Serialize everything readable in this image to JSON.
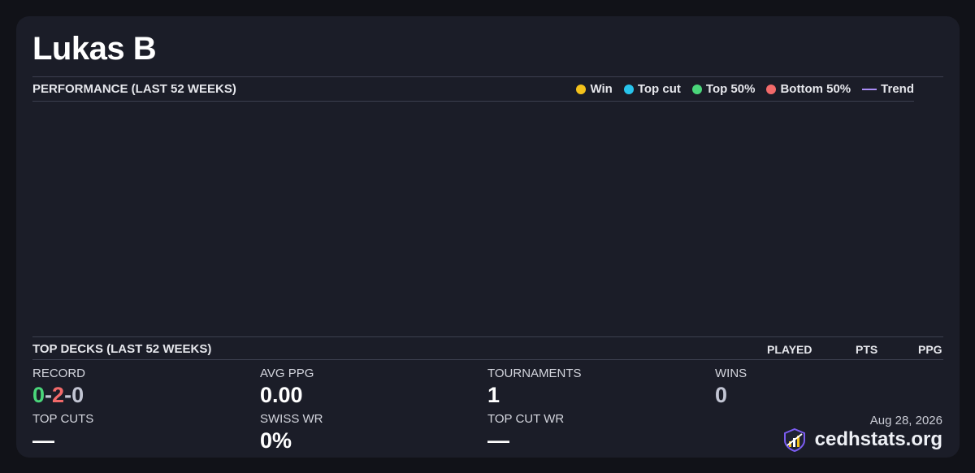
{
  "player": {
    "name": "Lukas B"
  },
  "performance": {
    "header": "PERFORMANCE (LAST 52 WEEKS)",
    "legend": [
      {
        "label": "Win",
        "color": "#f4c21b",
        "kind": "dot"
      },
      {
        "label": "Top cut",
        "color": "#28c4ec",
        "kind": "dot"
      },
      {
        "label": "Top 50%",
        "color": "#4ad67a",
        "kind": "dot"
      },
      {
        "label": "Bottom 50%",
        "color": "#f26a6a",
        "kind": "dot"
      },
      {
        "label": "Trend",
        "color": "#a98cf5",
        "kind": "line"
      }
    ]
  },
  "top_decks": {
    "header": "TOP DECKS (LAST 52 WEEKS)",
    "columns": {
      "played": "PLAYED",
      "pts": "PTS",
      "ppg": "PPG"
    }
  },
  "stats": {
    "record": {
      "label": "RECORD",
      "wins": "0",
      "losses": "2",
      "draws": "0",
      "sep": "-"
    },
    "avg_ppg": {
      "label": "AVG PPG",
      "value": "0.00"
    },
    "tournaments": {
      "label": "TOURNAMENTS",
      "value": "1"
    },
    "wins": {
      "label": "WINS",
      "value": "0"
    },
    "top_cuts": {
      "label": "TOP CUTS",
      "value": "—"
    },
    "swiss_wr": {
      "label": "SWISS WR",
      "value": "0%"
    },
    "top_cut_wr": {
      "label": "TOP CUT WR",
      "value": "—"
    }
  },
  "footer": {
    "date": "Aug 28, 2026",
    "brand": "cedhstats.org",
    "logo_icon": "bar-chart-shield-icon"
  },
  "colors": {
    "background": "#111218",
    "card": "#1b1d28",
    "accent": "#a98cf5",
    "win": "#4ad67a",
    "loss": "#f26a6a"
  }
}
